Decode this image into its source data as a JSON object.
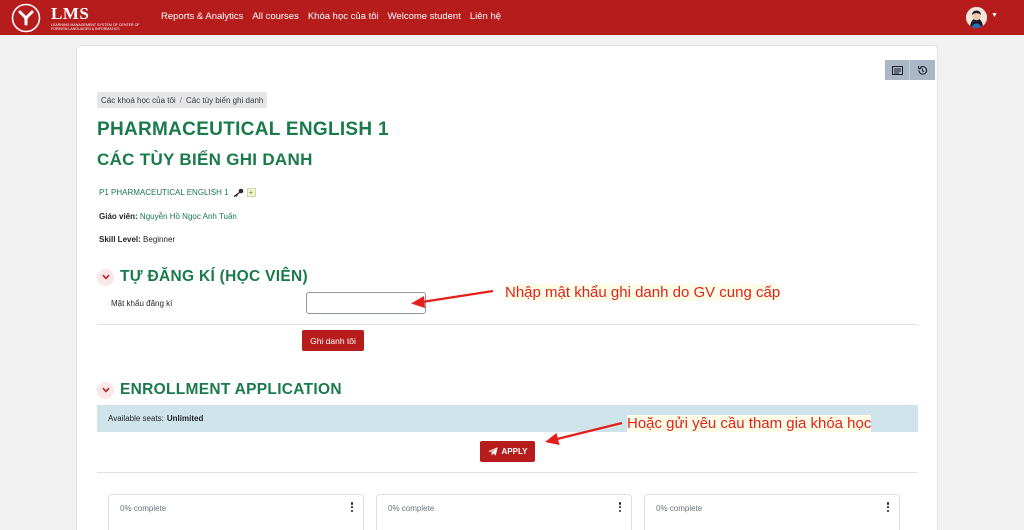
{
  "brand": {
    "name": "LMS",
    "tagline": "LEARNING MANAGEMENT SYSTEM OF CENTER OF FOREIGN LANGUAGES & INFORMATICS"
  },
  "nav": {
    "items": [
      {
        "label": "Reports & Analytics"
      },
      {
        "label": "All courses"
      },
      {
        "label": "Khóa học của tôi"
      },
      {
        "label": "Welcome student"
      },
      {
        "label": "Liên hệ"
      }
    ]
  },
  "toolbar": {
    "icons": [
      "course-index-icon",
      "history-icon"
    ]
  },
  "breadcrumb": {
    "items": [
      "Các khoá học của tôi",
      "Các tùy biến ghi danh"
    ],
    "separator": "/"
  },
  "course": {
    "title": "PHARMACEUTICAL ENGLISH 1",
    "page_title": "CÁC TÙY BIẾN GHI DANH",
    "shortname": "P1 PHARMACEUTICAL ENGLISH 1",
    "teacher_label": "Giáo viên:",
    "teacher_name": "Nguyễn Hồ Ngọc Anh Tuấn",
    "skill_label": "Skill Level:",
    "skill_value": "Beginner"
  },
  "self_enrol": {
    "heading": "TỰ ĐĂNG KÍ (HỌC VIÊN)",
    "password_label": "Mật khẩu đăng kí",
    "password_value": "",
    "submit_label": "Ghi danh tôi"
  },
  "application": {
    "heading": "ENROLLMENT APPLICATION",
    "seats_label": "Available seats:",
    "seats_value": "Unlimited",
    "apply_label": "APPLY"
  },
  "annotations": {
    "password_hint": "Nhập mật khẩu ghi danh do GV cung cấp",
    "apply_hint": "Hoặc gửi yêu cầu tham gia khóa học"
  },
  "course_cards": [
    {
      "progress_text": "0% complete",
      "progress": 0
    },
    {
      "progress_text": "0% complete",
      "progress": 0
    },
    {
      "progress_text": "0% complete",
      "progress": 0
    }
  ],
  "colors": {
    "brand_red": "#b71c1c",
    "title_green": "#1a7a4b",
    "annotation_red": "#e3201b",
    "info_box": "#cfe3ea"
  }
}
